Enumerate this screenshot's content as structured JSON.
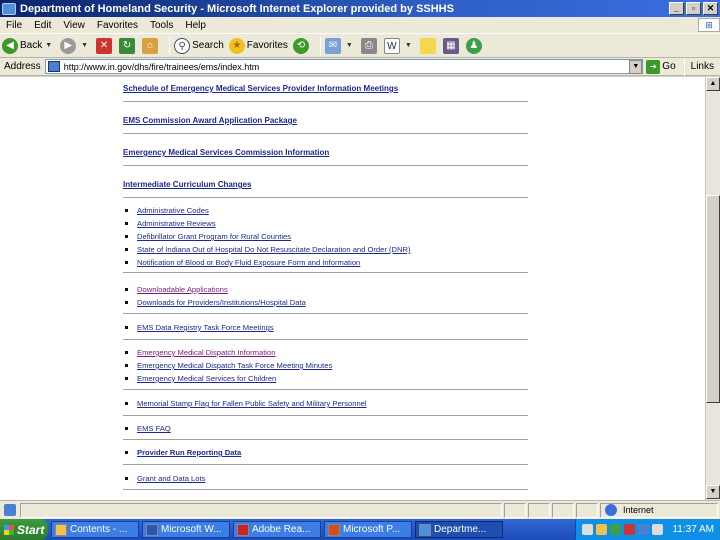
{
  "window": {
    "title": "Department of Homeland Security - Microsoft Internet Explorer provided by SSHHS"
  },
  "menu": [
    "File",
    "Edit",
    "View",
    "Favorites",
    "Tools",
    "Help"
  ],
  "toolbar": {
    "back": "Back",
    "search": "Search",
    "favorites": "Favorites"
  },
  "address": {
    "label": "Address",
    "url": "http://www.in.gov/dhs/fire/trainees/ems/index.htm",
    "go": "Go",
    "links": "Links"
  },
  "content": {
    "headings": [
      "Schedule of Emergency Medical Services Provider Information Meetings",
      "EMS Commission Award Application Package",
      "Emergency Medical Services Commission Information",
      "Intermediate Curriculum Changes"
    ],
    "list_groups": [
      [
        "Administrative Codes",
        "Administrative Reviews",
        "Defibrillator Grant Program for Rural Counties",
        "State of Indiana Out of Hospital Do Not Resuscitate Declaration and Order (DNR)",
        "Notification of Blood or Body Fluid Exposure Form and Information"
      ],
      [
        "Downloadable Applications",
        "Downloads for Providers/Institutions/Hospital Data"
      ],
      [
        "EMS Data Registry Task Force Meetings"
      ],
      [
        "Emergency Medical Dispatch Information",
        "Emergency Medical Dispatch Task Force Meeting Minutes",
        "Emergency Medical Services for Children"
      ],
      [
        "Memorial Stamp Flag for Fallen Public Safety and Military Personnel"
      ],
      [
        "EMS FAQ"
      ],
      [
        "Provider Run Reporting Data"
      ],
      [
        "Grant and Data Lots"
      ]
    ]
  },
  "status": {
    "zone": "Internet"
  },
  "taskbar": {
    "start": "Start",
    "tasks": [
      "Contents - ...",
      "Microsoft W...",
      "Adobe Rea...",
      "Microsoft P...",
      "Departme..."
    ],
    "clock": "11:37 AM"
  }
}
